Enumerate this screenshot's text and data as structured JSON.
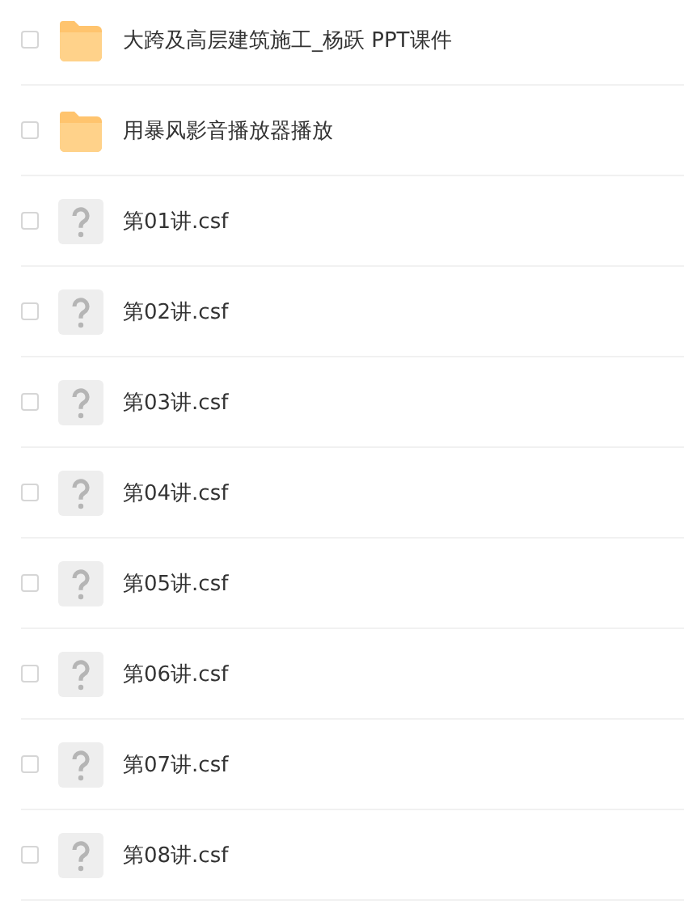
{
  "files": [
    {
      "kind": "folder",
      "name": "大跨及高层建筑施工_杨跃 PPT课件",
      "checked": false
    },
    {
      "kind": "folder",
      "name": "用暴风影音播放器播放",
      "checked": false
    },
    {
      "kind": "unknown",
      "name": "第01讲.csf",
      "checked": false
    },
    {
      "kind": "unknown",
      "name": "第02讲.csf",
      "checked": false
    },
    {
      "kind": "unknown",
      "name": "第03讲.csf",
      "checked": false
    },
    {
      "kind": "unknown",
      "name": "第04讲.csf",
      "checked": false
    },
    {
      "kind": "unknown",
      "name": "第05讲.csf",
      "checked": false
    },
    {
      "kind": "unknown",
      "name": "第06讲.csf",
      "checked": false
    },
    {
      "kind": "unknown",
      "name": "第07讲.csf",
      "checked": false
    },
    {
      "kind": "unknown",
      "name": "第08讲.csf",
      "checked": false
    }
  ]
}
